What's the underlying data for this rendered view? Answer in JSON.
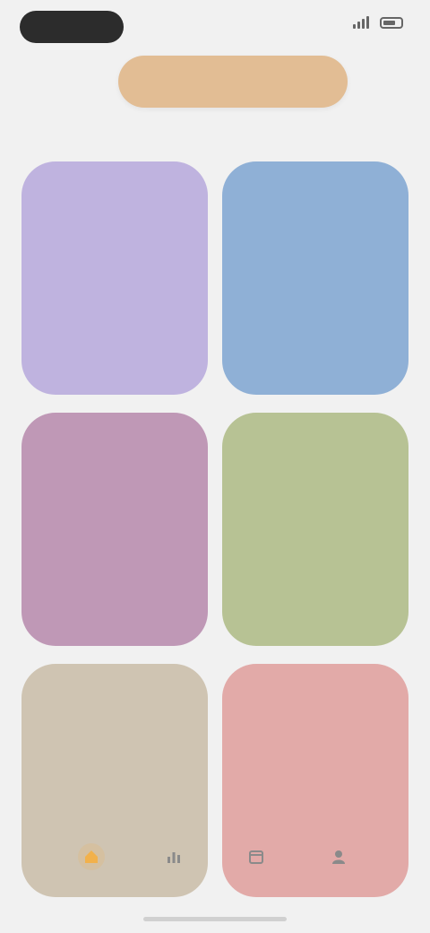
{
  "status_bar": {
    "time": "",
    "battery": ""
  },
  "header": {
    "title": ""
  },
  "section": {
    "title": ""
  },
  "cards": [
    {
      "title": "",
      "count": "",
      "color": "#bfb3df"
    },
    {
      "title": "",
      "count": "",
      "color": "#8fb0d6"
    },
    {
      "title": "",
      "count": "",
      "color": "#bf98b6"
    },
    {
      "title": "",
      "count": "",
      "color": "#b7c294"
    },
    {
      "title": "",
      "count": "",
      "color": "#cfc4b2"
    },
    {
      "title": "",
      "count": "",
      "color": "#e2aaa8"
    }
  ],
  "bottom_nav": [
    {
      "label": "",
      "icon": "home-icon",
      "color": "#f2b14b",
      "active": true
    },
    {
      "label": "",
      "icon": "chart-icon",
      "color": "#8a8a8a",
      "active": false
    },
    {
      "label": "",
      "icon": "calendar-icon",
      "color": "#8a8a8a",
      "active": false
    },
    {
      "label": "",
      "icon": "profile-icon",
      "color": "#8a8a8a",
      "active": false
    }
  ],
  "colors": {
    "background": "#f1f1f1",
    "header_pill": "#e2bd94",
    "accent": "#f2b14b"
  }
}
